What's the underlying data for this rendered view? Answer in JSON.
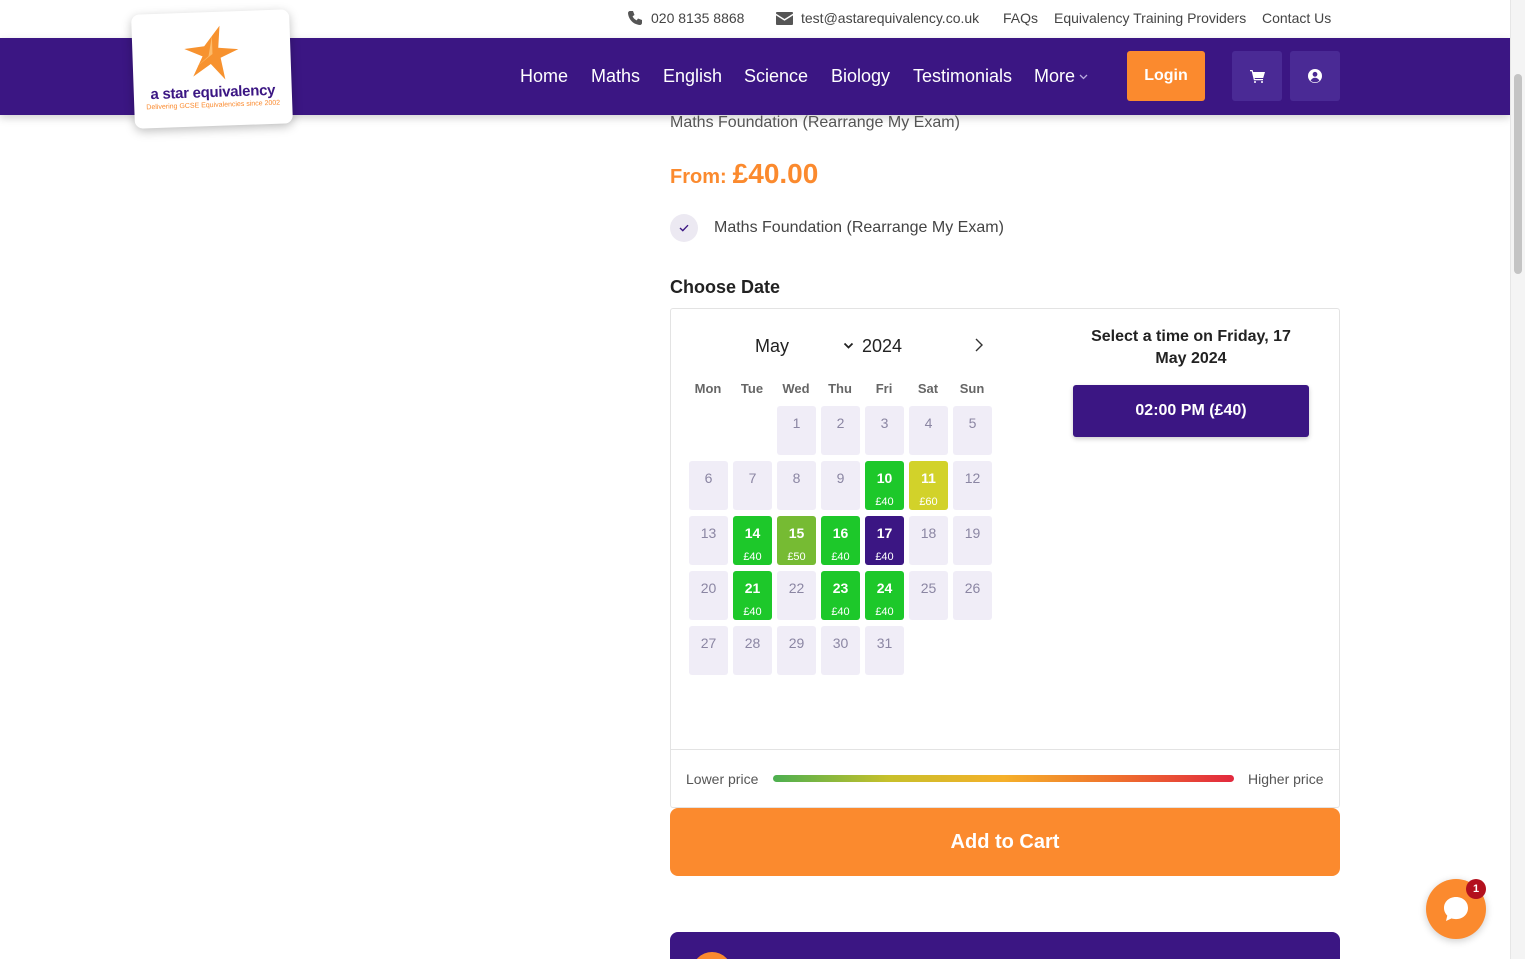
{
  "topbar": {
    "phone": "020 8135 8868",
    "email": "test@astarequivalency.co.uk",
    "links": [
      "FAQs",
      "Equivalency Training Providers",
      "Contact Us"
    ]
  },
  "logo": {
    "name": "a star equivalency",
    "tagline": "Delivering GCSE Equivalencies since 2002"
  },
  "nav": {
    "links": [
      "Home",
      "Maths",
      "English",
      "Science",
      "Biology",
      "Testimonials"
    ],
    "more": "More",
    "login": "Login",
    "icons": [
      "cart-icon",
      "user-icon"
    ]
  },
  "product": {
    "subtitle": "Maths Foundation (Rearrange My Exam)",
    "price_prefix": "From:",
    "price": "£40.00",
    "option": "Maths Foundation (Rearrange My Exam)",
    "choose_date": "Choose Date"
  },
  "calendar": {
    "month": "May",
    "year": "2024",
    "weekdays": [
      "Mon",
      "Tue",
      "Wed",
      "Thu",
      "Fri",
      "Sat",
      "Sun"
    ],
    "first_weekday_index": 2,
    "days_in_month": 31,
    "available": {
      "10": {
        "price": "£40",
        "color": "#1dc82a"
      },
      "11": {
        "price": "£60",
        "color": "#d2d22a"
      },
      "14": {
        "price": "£40",
        "color": "#1dc82a"
      },
      "15": {
        "price": "£50",
        "color": "#76bb33"
      },
      "16": {
        "price": "£40",
        "color": "#1dc82a"
      },
      "17": {
        "price": "£40",
        "color": "#3b1683"
      },
      "21": {
        "price": "£40",
        "color": "#1dc82a"
      },
      "23": {
        "price": "£40",
        "color": "#1dc82a"
      },
      "24": {
        "price": "£40",
        "color": "#1dc82a"
      }
    },
    "selected_day": 17,
    "time_heading": "Select a time on Friday, 17 May 2024",
    "time_slot": "02:00 PM (£40)",
    "legend_low": "Lower price",
    "legend_high": "Higher price"
  },
  "add_to_cart": "Add to Cart",
  "chat": {
    "badge": "1"
  },
  "colors": {
    "brand_purple": "#3b1683",
    "accent_orange": "#fb8a2e",
    "available_green": "#1dc82a"
  }
}
